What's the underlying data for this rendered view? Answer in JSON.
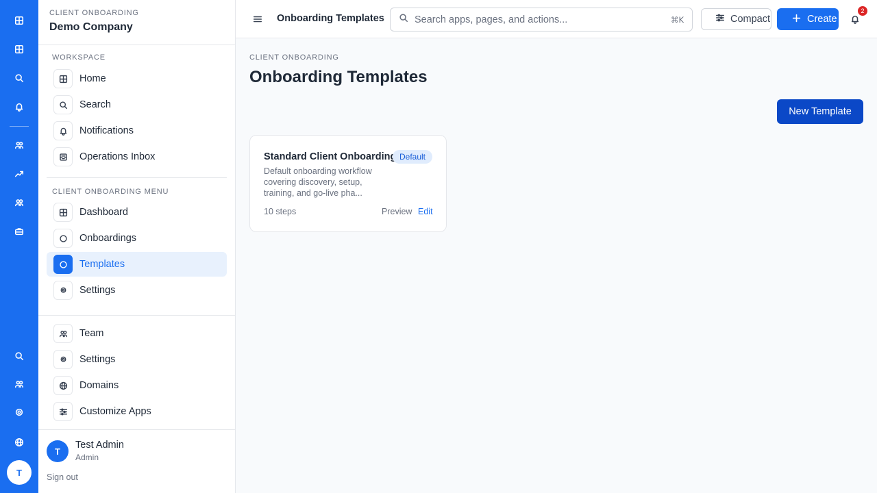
{
  "sidebar": {
    "kicker": "CLIENT ONBOARDING",
    "company": "Demo Company",
    "workspace_label": "WORKSPACE",
    "workspace_items": [
      {
        "label": "Home",
        "icon": "grid-icon"
      },
      {
        "label": "Search",
        "icon": "search-icon"
      },
      {
        "label": "Notifications",
        "icon": "bell-icon"
      },
      {
        "label": "Operations Inbox",
        "icon": "inbox-icon"
      }
    ],
    "menu_label": "CLIENT ONBOARDING MENU",
    "menu_items": [
      {
        "label": "Dashboard",
        "icon": "grid-icon"
      },
      {
        "label": "Onboardings",
        "icon": "circle-icon"
      },
      {
        "label": "Templates",
        "icon": "circle-icon",
        "active": true
      },
      {
        "label": "Settings",
        "icon": "gear-icon"
      }
    ],
    "admin_items": [
      {
        "label": "Team",
        "icon": "users-icon"
      },
      {
        "label": "Settings",
        "icon": "gear-icon"
      },
      {
        "label": "Domains",
        "icon": "globe-icon"
      },
      {
        "label": "Customize Apps",
        "icon": "sliders-icon"
      }
    ],
    "user": {
      "initial": "T",
      "name": "Test Admin",
      "role": "Admin",
      "sign_out": "Sign out"
    }
  },
  "rail": {
    "avatar_initial": "T"
  },
  "topbar": {
    "title": "Onboarding Templates",
    "search_placeholder": "Search apps, pages, and actions...",
    "shortcut": "⌘K",
    "compact_label": "Compact",
    "create_label": "Create",
    "notification_count": "2"
  },
  "main": {
    "kicker": "CLIENT ONBOARDING",
    "title": "Onboarding Templates",
    "new_template_label": "New Template",
    "templates": [
      {
        "name": "Standard Client Onboarding",
        "badge": "Default",
        "description": "Default onboarding workflow covering discovery, setup, training, and go-live pha...",
        "steps": "10 steps",
        "preview_label": "Preview",
        "edit_label": "Edit"
      }
    ]
  },
  "colors": {
    "accent": "#1a6ef0",
    "primary_dark": "#0b48c7",
    "badge_bg": "#e0ecfd",
    "danger": "#dc2626"
  }
}
